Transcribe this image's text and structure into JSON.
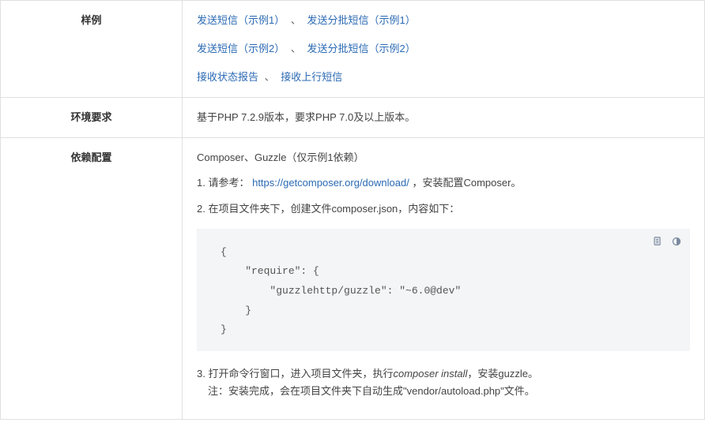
{
  "rows": {
    "samples": {
      "label": "样例",
      "line1_link1": "发送短信（示例1）",
      "line1_sep": "、",
      "line1_link2": "发送分批短信（示例1）",
      "line2_link1": "发送短信（示例2）",
      "line2_sep": "、",
      "line2_link2": "发送分批短信（示例2）",
      "line3_link1": "接收状态报告",
      "line3_sep": "、",
      "line3_link2": "接收上行短信"
    },
    "env": {
      "label": "环境要求",
      "text": "基于PHP 7.2.9版本，要求PHP 7.0及以上版本。"
    },
    "deps": {
      "label": "依赖配置",
      "intro": "Composer、Guzzle（仅示例1依赖）",
      "step1_prefix": "1. 请参考：",
      "step1_link": "https://getcomposer.org/download/",
      "step1_suffix": "，安装配置Composer。",
      "step2": "2. 在项目文件夹下，创建文件composer.json，内容如下：",
      "code": "{\n    \"require\": {\n        \"guzzlehttp/guzzle\": \"~6.0@dev\"\n    }\n}",
      "step3_prefix": "3. 打开命令行窗口，进入项目文件夹，执行",
      "step3_cmd": "composer install",
      "step3_suffix": "，安装guzzle。",
      "step3_note": "注：安装完成，会在项目文件夹下自动生成\"vendor/autoload.php\"文件。"
    }
  },
  "icons": {
    "copy": "copy-icon",
    "theme": "theme-toggle-icon"
  }
}
